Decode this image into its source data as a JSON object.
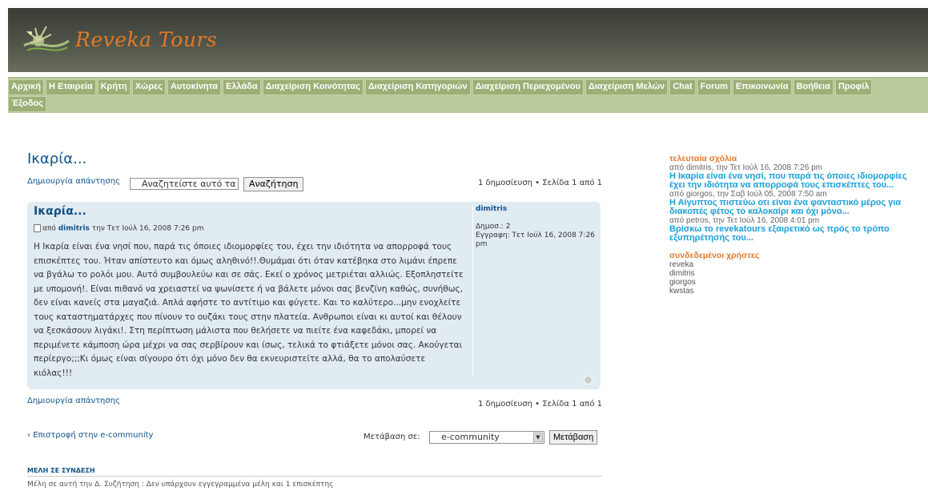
{
  "brand": {
    "name": "Reveka Tours",
    "accent": "#e07a2a",
    "header_bg": "#4a4d43",
    "nav_bg": "#9caf76"
  },
  "nav": {
    "row1": [
      "Αρχική",
      "Η Εταιρεία",
      "Κρήτη",
      "Χώρες",
      "Αυτοκίνητα",
      "Ελλάδα",
      "Διαχείριση Κοινότητας",
      "Διαχείριση Κατηγοριών",
      "Διαχείριση Περιεχομένου",
      "Διαχείριση Μελών",
      "Chat",
      "Forum",
      "Επικοινωνία",
      "Βοήθεια",
      "Προφίλ"
    ],
    "row2": [
      "Έξοδος"
    ]
  },
  "topic": {
    "title": "Ικαρία...",
    "reply_link": "Δημιουργία απάντησης",
    "search_placeholder": "Αναζητείστε αυτό τα",
    "search_button": "Αναζήτηση",
    "pagination": "1 δημοσίευση • Σελίδα 1 από 1"
  },
  "post": {
    "title": "Ικαρία...",
    "author_prefix": "από",
    "author": "dimitris",
    "date_text": "την Τετ Ιούλ 16, 2008 7:26 pm",
    "body": "Η Ικαρία είναι ένα νησί που, παρά τις όποιες ιδιομορφίες του, έχει την ιδιότητα να απορροφά τους επισκέπτες του. Ήταν απίστευτο και όμως αληθινό!!.Θυμάμαι ότι όταν κατέβηκα στο λιμάνι έπρεπε να βγάλω το ρολόι μου. Αυτό συμβουλεύω και σε σάς. Εκεί ο χρόνος μετριέται αλλιώς. Εξοπληστείτε με υπομονή!. Είναι πιθανό να χρειαστεί να ψωνίσετε ή να βάλετε μόνοι σας βενζίνη καθώς, συνήθως, δεν είναι κανείς στα μαγαζιά. Απλά αφήστε το αντίτιμο και φύγετε. Και το καλύτερο...μην ενοχλείτε τους καταστηματάρχες που πίνουν το ουζάκι τους στην πλατεία. Ανθρωποι είναι κι αυτοί και θέλουν να ξεσκάσουν λιγάκι!. Στη περίπτωση μάλιστα που θελήσετε να πιείτε ένα καφεδάκι, μπορεί να περιμένετε κάμποση ώρα μέχρι να σας σερβίρουν και ίσως, τελικά το φτιάξετε μόνοι σας. Ακούγεται περίεργο;;;Κι όμως είναι σίγουρο ότι όχι μόνο δεν θα εκνευριστείτε αλλά, θα το απολαύσετε κιόλας!!!",
    "profile": {
      "name": "dimitris",
      "posts_label": "Δημοσ.:",
      "posts_value": "2",
      "joined_label": "Εγγραφη:",
      "joined_value": "Τετ Ιούλ 16, 2008 7:26 pm"
    }
  },
  "bottom": {
    "reply_link": "Δημιουργία απάντησης",
    "pagination": "1 δημοσίευση • Σελίδα 1 από 1",
    "return_link": "Επιστροφή στην e-community",
    "jump_label": "Μετάβαση σε:",
    "jump_selected": "e-community",
    "jump_button": "Μετάβαση",
    "online_heading": "ΜΕΛΗ ΣΕ ΣΥΝΔΕΣΗ",
    "online_text": "Μέλη σε αυτή την Δ. Συζήτηση : Δεν υπάρχουν εγγεγραμμένα μέλη και 1 επισκέπτης"
  },
  "sidebar": {
    "comments_heading": "τελευταία σχόλια",
    "comments": [
      {
        "meta": "από dimitris, την Τετ Ιούλ 16, 2008 7:26 pm",
        "line1": "Η Ικαρία είναι ένα νησί, που παρά τις όποιες ιδιομορφίες",
        "line2": "έχει την ιδιότητα να απορροφά τους επισκέπτες του..."
      },
      {
        "meta": "από giorgos, την Σαβ Ιούλ 05, 2008 7:50 am",
        "line1": "Η Αίγυπτος πιστεύω οτι είναι ένα φανταστικό μέρος για",
        "line2": "διακοπές φέτος το καλοκαίρι και όχι μόνο..."
      },
      {
        "meta": "από petros, την Τετ Ιούλ 16, 2008 4:01 pm",
        "line1": "Βρίσκω το revekatours εξαιρετικό ως πρός το τρόπο",
        "line2": "εξυπηρέτησής του..."
      }
    ],
    "users_heading": "συνδεδεμένοι χρήστες",
    "users": [
      "reveka",
      "dimitris",
      "giorgos",
      "kwstas"
    ]
  }
}
